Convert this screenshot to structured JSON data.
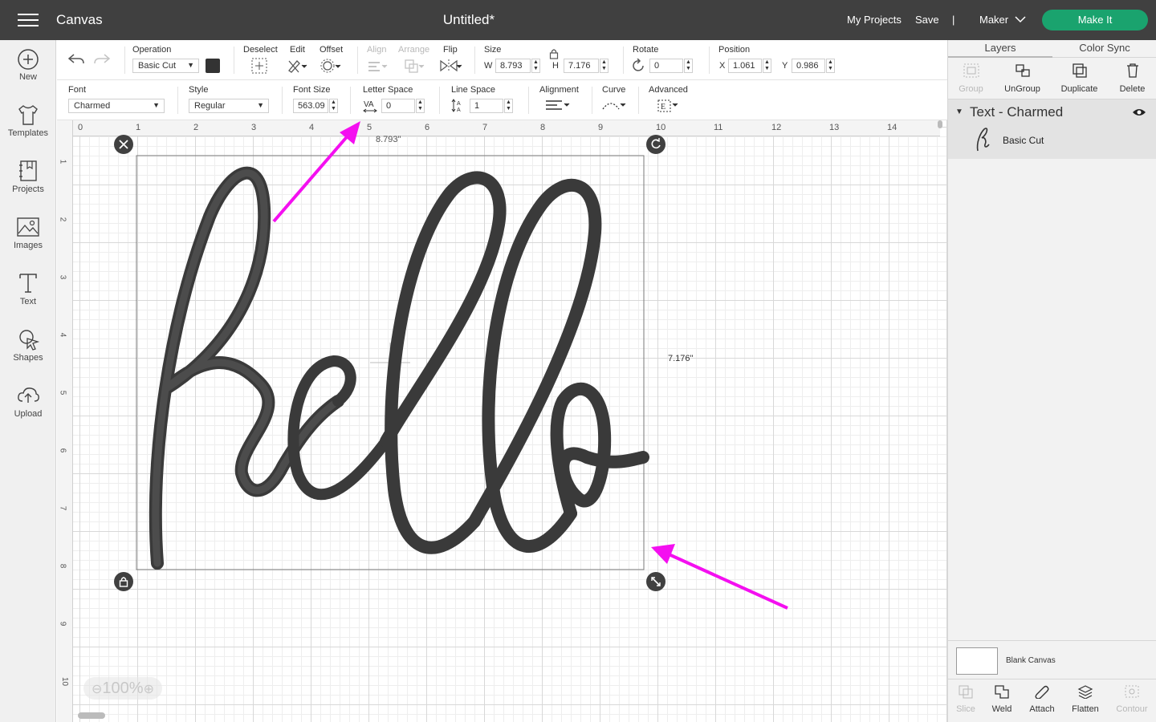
{
  "topbar": {
    "app_title": "Canvas",
    "doc_title": "Untitled*",
    "my_projects": "My Projects",
    "save": "Save",
    "divider": "|",
    "machine": "Maker",
    "make_it": "Make It"
  },
  "sidebar": {
    "items": [
      {
        "label": "New",
        "icon": "plus-circle-icon"
      },
      {
        "label": "Templates",
        "icon": "shirt-icon"
      },
      {
        "label": "Projects",
        "icon": "projects-icon"
      },
      {
        "label": "Images",
        "icon": "image-icon"
      },
      {
        "label": "Text",
        "icon": "text-icon"
      },
      {
        "label": "Shapes",
        "icon": "shapes-icon"
      },
      {
        "label": "Upload",
        "icon": "upload-icon"
      }
    ]
  },
  "toolbar1": {
    "operation_label": "Operation",
    "operation_value": "Basic Cut",
    "deselect": "Deselect",
    "edit": "Edit",
    "offset": "Offset",
    "align": "Align",
    "arrange": "Arrange",
    "flip": "Flip",
    "size_label": "Size",
    "w_label": "W",
    "w_value": "8.793",
    "h_label": "H",
    "h_value": "7.176",
    "rotate_label": "Rotate",
    "rotate_value": "0",
    "position_label": "Position",
    "x_label": "X",
    "x_value": "1.061",
    "y_label": "Y",
    "y_value": "0.986",
    "swatch_color": "#333333"
  },
  "toolbar2": {
    "font_label": "Font",
    "font_value": "Charmed",
    "style_label": "Style",
    "style_value": "Regular",
    "font_size_label": "Font Size",
    "font_size_value": "563.09",
    "letter_space_label": "Letter Space",
    "letter_space_value": "0",
    "line_space_label": "Line Space",
    "line_space_value": "1",
    "alignment_label": "Alignment",
    "curve_label": "Curve",
    "advanced_label": "Advanced"
  },
  "canvas": {
    "h_ruler": [
      "0",
      "1",
      "2",
      "3",
      "4",
      "5",
      "6",
      "7",
      "8",
      "9",
      "10",
      "11",
      "12",
      "13",
      "14"
    ],
    "v_ruler": [
      "1",
      "2",
      "3",
      "4",
      "5",
      "6",
      "7",
      "8",
      "9",
      "10"
    ],
    "width_dim": "8.793\"",
    "height_dim": "7.176\"",
    "zoom": "100%",
    "text_color": "#3a3a3a",
    "arrow_color": "#f40ff0"
  },
  "right_panel": {
    "tabs": [
      "Layers",
      "Color Sync"
    ],
    "actions": [
      "Group",
      "UnGroup",
      "Duplicate",
      "Delete"
    ],
    "layer_title": "Text - Charmed",
    "layer_sub": "Basic Cut",
    "blank_canvas": "Blank Canvas",
    "bottom_actions": [
      "Slice",
      "Weld",
      "Attach",
      "Flatten",
      "Contour"
    ]
  }
}
